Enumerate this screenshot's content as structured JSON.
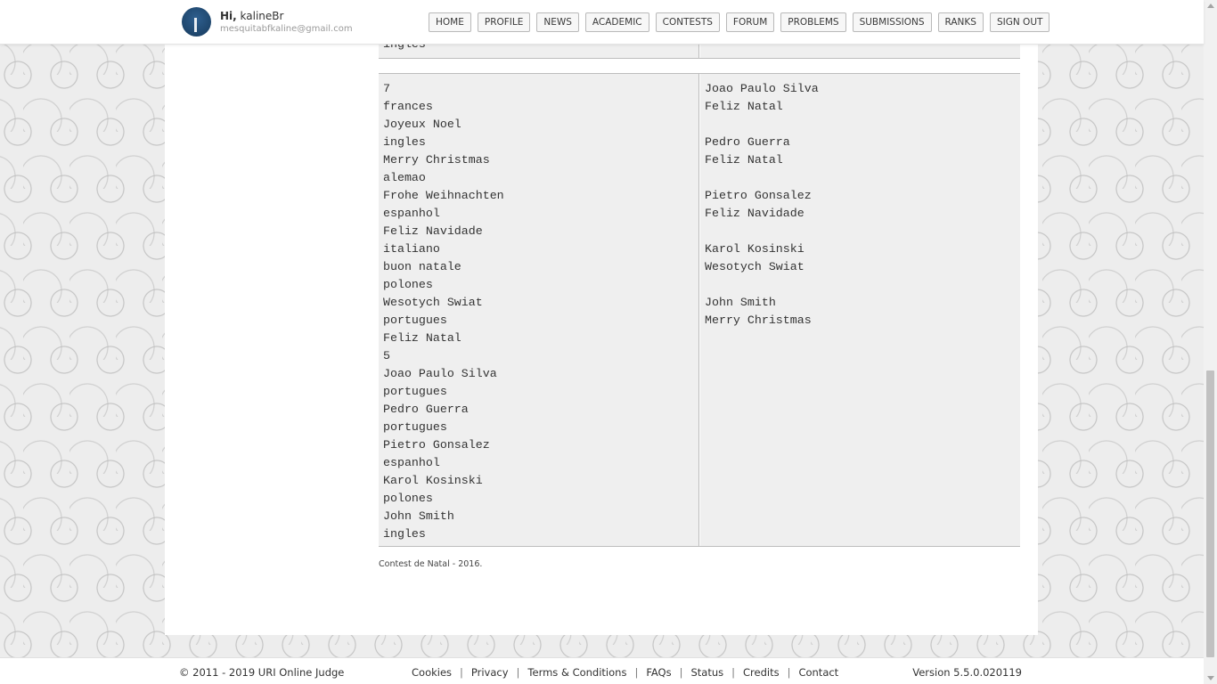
{
  "header": {
    "greeting_prefix": "Hi,",
    "username": "kalineBr",
    "email": "mesquitabfkaline@gmail.com",
    "nav": [
      "HOME",
      "PROFILE",
      "NEWS",
      "ACADEMIC",
      "CONTESTS",
      "FORUM",
      "PROBLEMS",
      "SUBMISSIONS",
      "RANKS",
      "SIGN OUT"
    ]
  },
  "sample": {
    "prev_input_tail": "ingles",
    "input_lines": [
      "7",
      "frances",
      "Joyeux Noel",
      "ingles",
      "Merry Christmas",
      "alemao",
      "Frohe Weihnachten",
      "espanhol",
      "Feliz Navidade",
      "italiano",
      "buon natale",
      "polones",
      "Wesotych Swiat",
      "portugues",
      "Feliz Natal",
      "5",
      "Joao Paulo Silva",
      "portugues",
      "Pedro Guerra",
      "portugues",
      "Pietro Gonsalez",
      "espanhol",
      "Karol Kosinski",
      "polones",
      "John Smith",
      "ingles"
    ],
    "output_lines": [
      "Joao Paulo Silva",
      "Feliz Natal",
      "",
      "Pedro Guerra",
      "Feliz Natal",
      "",
      "Pietro Gonsalez",
      "Feliz Navidade",
      "",
      "Karol Kosinski",
      "Wesotych Swiat",
      "",
      "John Smith",
      "Merry Christmas"
    ]
  },
  "credit": "Contest de Natal - 2016.",
  "footer": {
    "copyright": "© 2011 - 2019 URI Online Judge",
    "links": [
      "Cookies",
      "Privacy",
      "Terms & Conditions",
      "FAQs",
      "Status",
      "Credits",
      "Contact"
    ],
    "version": "Version 5.5.0.020119"
  }
}
